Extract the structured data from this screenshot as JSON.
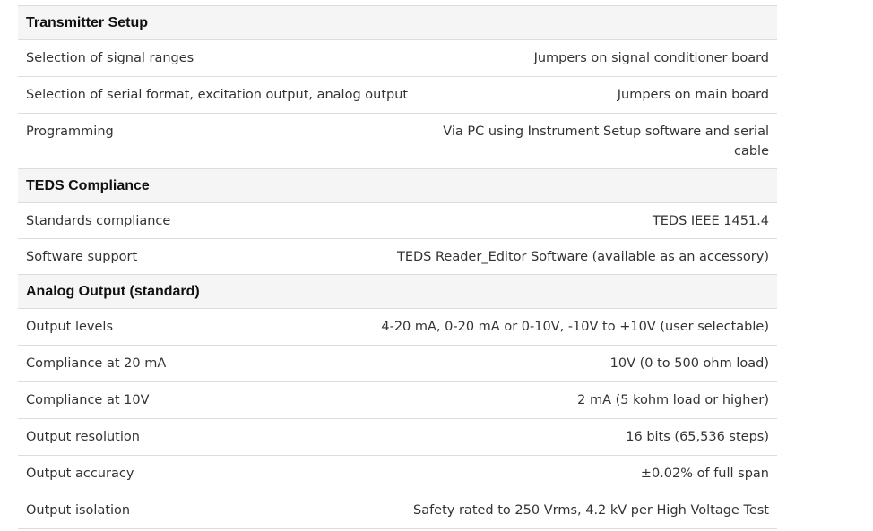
{
  "sections": [
    {
      "title": "Transmitter Setup",
      "rows": [
        {
          "label": "Selection of signal ranges",
          "value": "Jumpers on signal conditioner board"
        },
        {
          "label": "Selection of serial format, excitation output, analog output",
          "value": "Jumpers on main board"
        },
        {
          "label": "Programming",
          "value": "Via PC using Instrument Setup software and serial cable"
        }
      ]
    },
    {
      "title": "TEDS Compliance",
      "rows": [
        {
          "label": "Standards compliance",
          "value": "TEDS IEEE 1451.4"
        },
        {
          "label": "Software support",
          "value": "TEDS Reader_Editor Software (available as an accessory)"
        }
      ]
    },
    {
      "title": "Analog Output (standard)",
      "rows": [
        {
          "label": "Output levels",
          "value": "4-20 mA, 0-20 mA or 0-10V, -10V to +10V (user selectable)"
        },
        {
          "label": "Compliance at 20 mA",
          "value": "10V (0 to 500 ohm load)"
        },
        {
          "label": "Compliance at 10V",
          "value": "2 mA (5 kohm load or higher)"
        },
        {
          "label": "Output resolution",
          "value": "16 bits (65,536 steps)"
        },
        {
          "label": "Output accuracy",
          "value": "±0.02% of full span"
        },
        {
          "label": "Output isolation",
          "value": "Safety rated to 250 Vrms, 4.2 kV per High Voltage Test"
        }
      ]
    }
  ]
}
